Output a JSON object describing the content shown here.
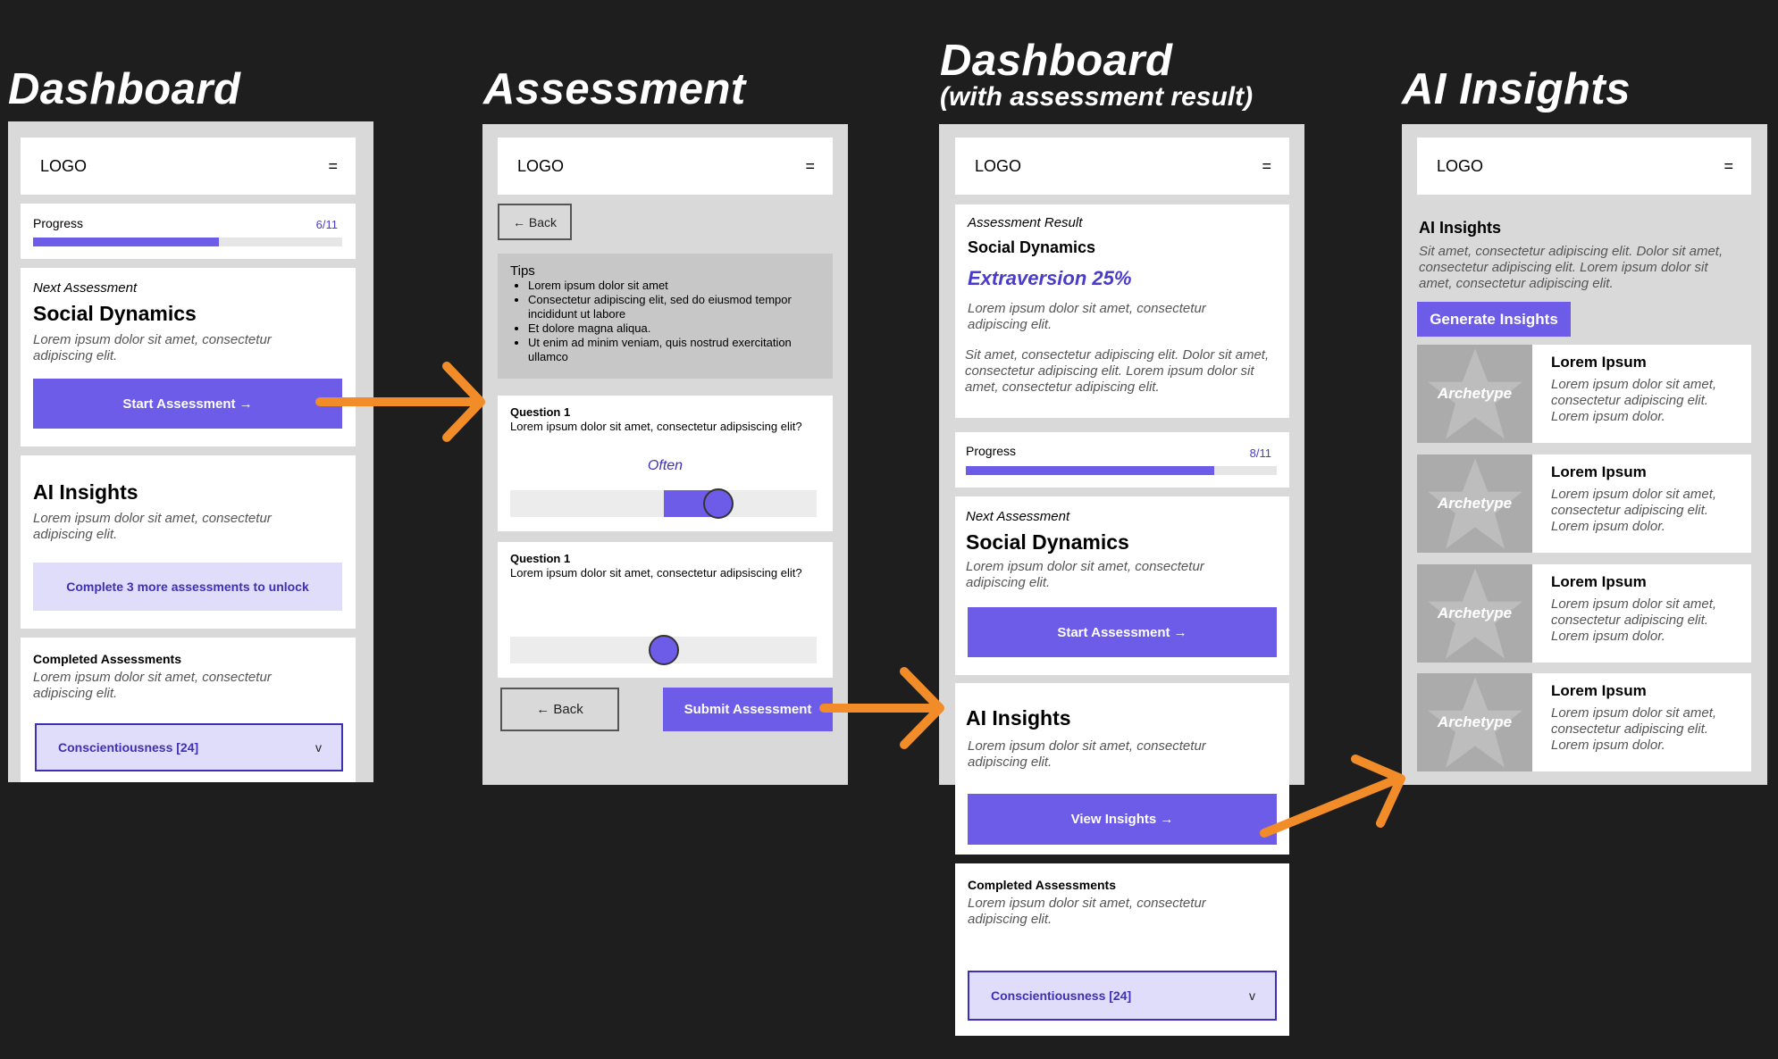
{
  "titles": {
    "dashboard": "Dashboard",
    "assessment": "Assessment",
    "dashboard_result": "Dashboard",
    "dashboard_result_sub": "(with assessment result)",
    "ai_insights": "AI Insights"
  },
  "header": {
    "logo": "LOGO",
    "menu": "="
  },
  "dashboard": {
    "progress_label": "Progress",
    "progress_count": "6/11",
    "progress_value": 0.6,
    "next_label": "Next Assessment",
    "next_title": "Social Dynamics",
    "next_desc": "Lorem ipsum dolor sit amet, consectetur adipiscing elit.",
    "start_button": "Start Assessment →",
    "ai_title": "AI Insights",
    "ai_desc": "Lorem ipsum dolor sit amet, consectetur adipiscing elit.",
    "unlock_button": "Complete 3 more assessments to unlock",
    "completed_title": "Completed Assessments",
    "completed_desc": "Lorem ipsum dolor sit amet, consectetur adipiscing elit.",
    "completed_select": "Conscientiousness  [24]",
    "chevron": "v"
  },
  "assessment": {
    "back_top": "← Back",
    "tips_title": "Tips",
    "tips": [
      "Lorem ipsum dolor sit amet",
      "Consectetur adipiscing elit, sed do eiusmod tempor incididunt ut labore",
      "Et dolore magna aliqua.",
      "Ut enim ad minim veniam, quis nostrud exercitation ullamco"
    ],
    "q1_label": "Question 1",
    "q1_text": "Lorem ipsum dolor sit amet, consectetur adipsiscing elit?",
    "q1_answer": "Often",
    "q1_value": 0.68,
    "q2_label": "Question 1",
    "q2_text": "Lorem ipsum dolor sit amet, consectetur adipsiscing elit?",
    "q2_value": 0.5,
    "back_bottom": "← Back",
    "submit_button": "Submit Assessment"
  },
  "dashboard_result": {
    "result_label": "Assessment Result",
    "result_title": "Social Dynamics",
    "result_value": "Extraversion 25%",
    "result_desc": "Lorem ipsum dolor sit amet, consectetur adipiscing elit.",
    "result_desc2": "Sit amet, consectetur adipiscing elit. Dolor sit amet, consectetur adipiscing elit. Lorem ipsum dolor sit amet, consectetur adipiscing elit.",
    "progress_label": "Progress",
    "progress_count": "8/11",
    "progress_value": 0.8,
    "next_label": "Next Assessment",
    "next_title": "Social Dynamics",
    "next_desc": "Lorem ipsum dolor sit amet, consectetur adipiscing elit.",
    "start_button": "Start Assessment →",
    "ai_title": "AI Insights",
    "ai_desc": "Lorem ipsum dolor sit amet, consectetur adipiscing elit.",
    "view_button": "View Insights →",
    "completed_title": "Completed Assessments",
    "completed_desc": "Lorem ipsum dolor sit amet, consectetur adipiscing elit.",
    "completed_select": "Conscientiousness  [24]",
    "chevron": "v"
  },
  "ai_insights": {
    "title": "AI Insights",
    "desc": "Sit amet, consectetur adipiscing elit. Dolor sit amet, consectetur adipiscing elit. Lorem ipsum dolor sit amet, consectetur adipiscing elit.",
    "generate_button": "Generate Insights",
    "items": [
      {
        "image_label": "Archetype",
        "title": "Lorem Ipsum",
        "text": "Lorem ipsum dolor sit amet, consectetur adipiscing elit. Lorem ipsum dolor."
      },
      {
        "image_label": "Archetype",
        "title": "Lorem Ipsum",
        "text": "Lorem ipsum dolor sit amet, consectetur adipiscing elit. Lorem ipsum dolor."
      },
      {
        "image_label": "Archetype",
        "title": "Lorem Ipsum",
        "text": "Lorem ipsum dolor sit amet, consectetur adipiscing elit. Lorem ipsum dolor."
      },
      {
        "image_label": "Archetype",
        "title": "Lorem Ipsum",
        "text": "Lorem ipsum dolor sit amet, consectetur adipiscing elit. Lorem ipsum dolor."
      }
    ]
  },
  "colors": {
    "accent": "#6c5ce7",
    "arrow": "#f28c28",
    "background": "#1e1e1e",
    "frame": "#d9d9d9"
  }
}
